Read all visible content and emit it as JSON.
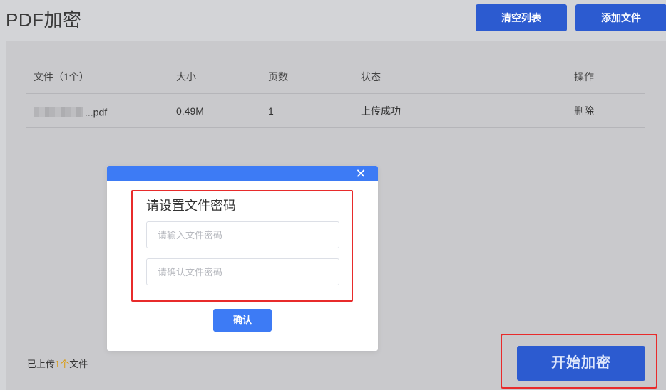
{
  "header": {
    "title": "PDF加密",
    "clear_label": "清空列表",
    "add_label": "添加文件"
  },
  "table": {
    "columns": [
      "文件（1个）",
      "大小",
      "页数",
      "状态",
      "操作"
    ],
    "rows": [
      {
        "name": "...pdf",
        "size": "0.49M",
        "pages": "1",
        "status": "上传成功",
        "action": "删除"
      }
    ]
  },
  "footer": {
    "status_prefix": "已上传",
    "status_count": "1个",
    "status_suffix": "文件",
    "start_label": "开始加密"
  },
  "modal": {
    "close_glyph": "✕",
    "label": "请设置文件密码",
    "password_placeholder": "请输入文件密码",
    "confirm_placeholder": "请确认文件密码",
    "password_value": "",
    "confirm_value": "",
    "confirm_label": "确认"
  },
  "colors": {
    "primary": "#2c5bd0",
    "modal_accent": "#3d7bf5",
    "highlight": "#e82b2b",
    "count_accent": "#d99b10"
  }
}
